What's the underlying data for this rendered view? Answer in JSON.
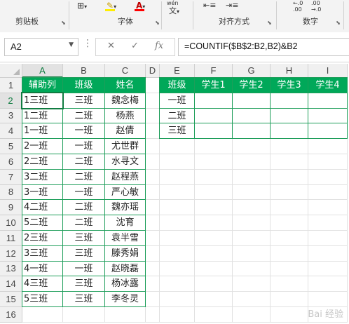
{
  "ribbon": {
    "groups": [
      {
        "label": "剪贴板"
      },
      {
        "label": "字体"
      },
      {
        "label": "对齐方式"
      },
      {
        "label": "数字"
      }
    ],
    "wen_label": "wén\n文"
  },
  "formula_bar": {
    "name_box": "A2",
    "formula": "=COUNTIF($B$2:B2,B2)&B2",
    "fx_label": "fx"
  },
  "columns": [
    "A",
    "B",
    "C",
    "D",
    "E",
    "F",
    "G",
    "H",
    "I"
  ],
  "rows": [
    "1",
    "2",
    "3",
    "4",
    "5",
    "6",
    "7",
    "8",
    "9",
    "10",
    "11",
    "12",
    "13",
    "14",
    "15",
    "16"
  ],
  "sheet": {
    "headers": {
      "A": "辅助列",
      "B": "班级",
      "C": "姓名"
    },
    "data": [
      {
        "A": "1三班",
        "B": "三班",
        "C": "魏念梅"
      },
      {
        "A": "1二班",
        "B": "二班",
        "C": "杨燕"
      },
      {
        "A": "1一班",
        "B": "一班",
        "C": "赵倩"
      },
      {
        "A": "2一班",
        "B": "一班",
        "C": "尤世群"
      },
      {
        "A": "2二班",
        "B": "二班",
        "C": "水寻文"
      },
      {
        "A": "3二班",
        "B": "二班",
        "C": "赵程燕"
      },
      {
        "A": "3一班",
        "B": "一班",
        "C": "严心敏"
      },
      {
        "A": "4二班",
        "B": "二班",
        "C": "魏亦瑶"
      },
      {
        "A": "5二班",
        "B": "二班",
        "C": "沈育"
      },
      {
        "A": "2三班",
        "B": "三班",
        "C": "袁半雪"
      },
      {
        "A": "3三班",
        "B": "三班",
        "C": "滕秀娟"
      },
      {
        "A": "4一班",
        "B": "一班",
        "C": "赵晓磊"
      },
      {
        "A": "4三班",
        "B": "三班",
        "C": "杨冰露"
      },
      {
        "A": "5三班",
        "B": "三班",
        "C": "李冬灵"
      }
    ],
    "result_table": {
      "headers": [
        "班级",
        "学生1",
        "学生2",
        "学生3",
        "学生4"
      ],
      "rows": [
        "一班",
        "二班",
        "三班"
      ]
    }
  },
  "watermark": "Bai 经验",
  "colors": {
    "header_green": "#00a859",
    "border_green": "#1e9e5a",
    "accent": "#107c41"
  }
}
